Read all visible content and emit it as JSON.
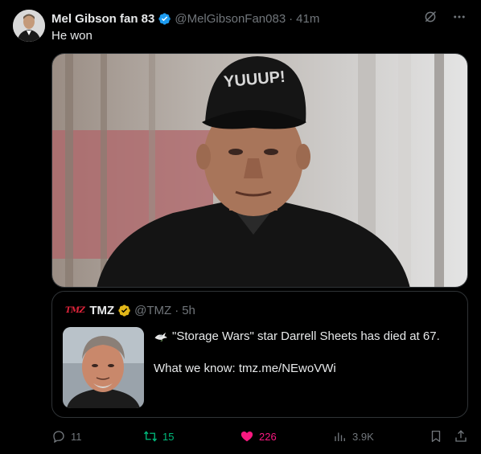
{
  "tweet": {
    "display_name": "Mel Gibson fan 83",
    "handle": "@MelGibsonFan083",
    "time": "41m",
    "text": "He won",
    "media_cap_text": "YUUUP!"
  },
  "quote": {
    "logo": "TMZ",
    "display_name": "TMZ",
    "handle": "@TMZ",
    "time": "5h",
    "line1": "\"Storage Wars\" star Darrell Sheets has died at 67.",
    "line2": "What we know: tmz.me/NEwoVWi"
  },
  "actions": {
    "replies": "11",
    "reposts": "15",
    "likes": "226",
    "views": "3.9K"
  },
  "colors": {
    "background": "#000000",
    "text": "#e7e9ea",
    "muted": "#71767b",
    "verified_blue": "#1d9bf0",
    "verified_gold": "#e2b719",
    "repost_green": "#00ba7c",
    "like_pink": "#f91880",
    "tmz_red": "#e0243b"
  },
  "icons": {
    "verified": "verified-badge-icon",
    "grok": "grok-icon",
    "more": "more-icon",
    "dove": "dove-icon",
    "reply": "reply-icon",
    "repost": "repost-icon",
    "like": "heart-icon",
    "views": "views-icon",
    "bookmark": "bookmark-icon",
    "share": "share-icon"
  }
}
